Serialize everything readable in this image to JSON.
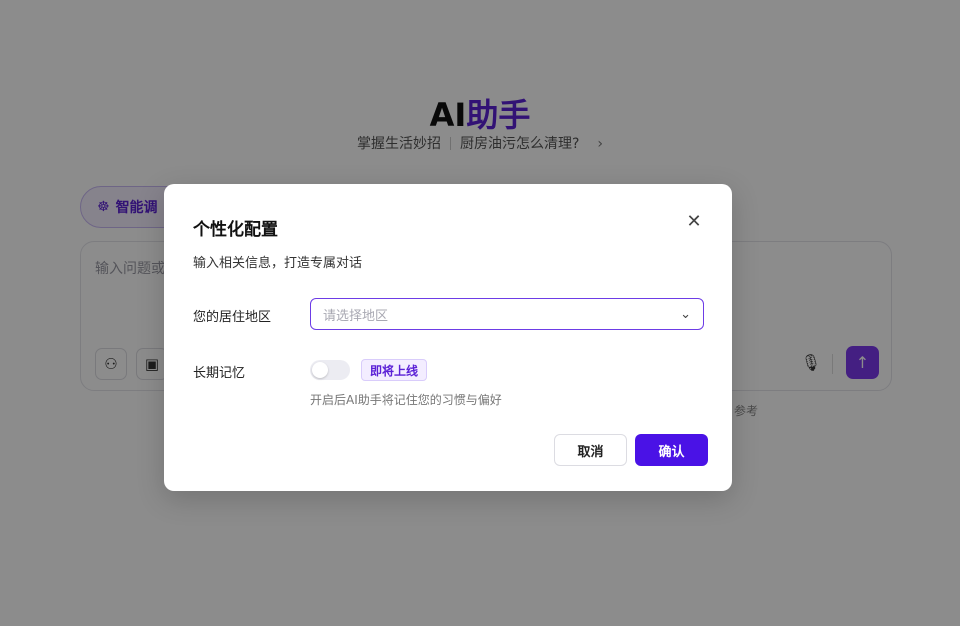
{
  "background": {
    "title_prefix": "AI",
    "title_accent": "助手",
    "subtitle_left": "掌握生活妙招",
    "subtitle_right": "厨房油污怎么清理?",
    "smart_button_label": "智能调",
    "input_placeholder": "输入问题或",
    "footnote": "参考"
  },
  "modal": {
    "title": "个性化配置",
    "description": "输入相关信息，打造专属对话",
    "region_label": "您的居住地区",
    "region_placeholder": "请选择地区",
    "memory_label": "长期记忆",
    "memory_badge": "即将上线",
    "memory_hint": "开启后AI助手将记住您的习惯与偏好",
    "memory_enabled": false,
    "cancel_label": "取消",
    "confirm_label": "确认"
  },
  "colors": {
    "accent": "#5b21d6",
    "confirm_button": "#4a12e6",
    "send_button": "#7c3aed"
  }
}
